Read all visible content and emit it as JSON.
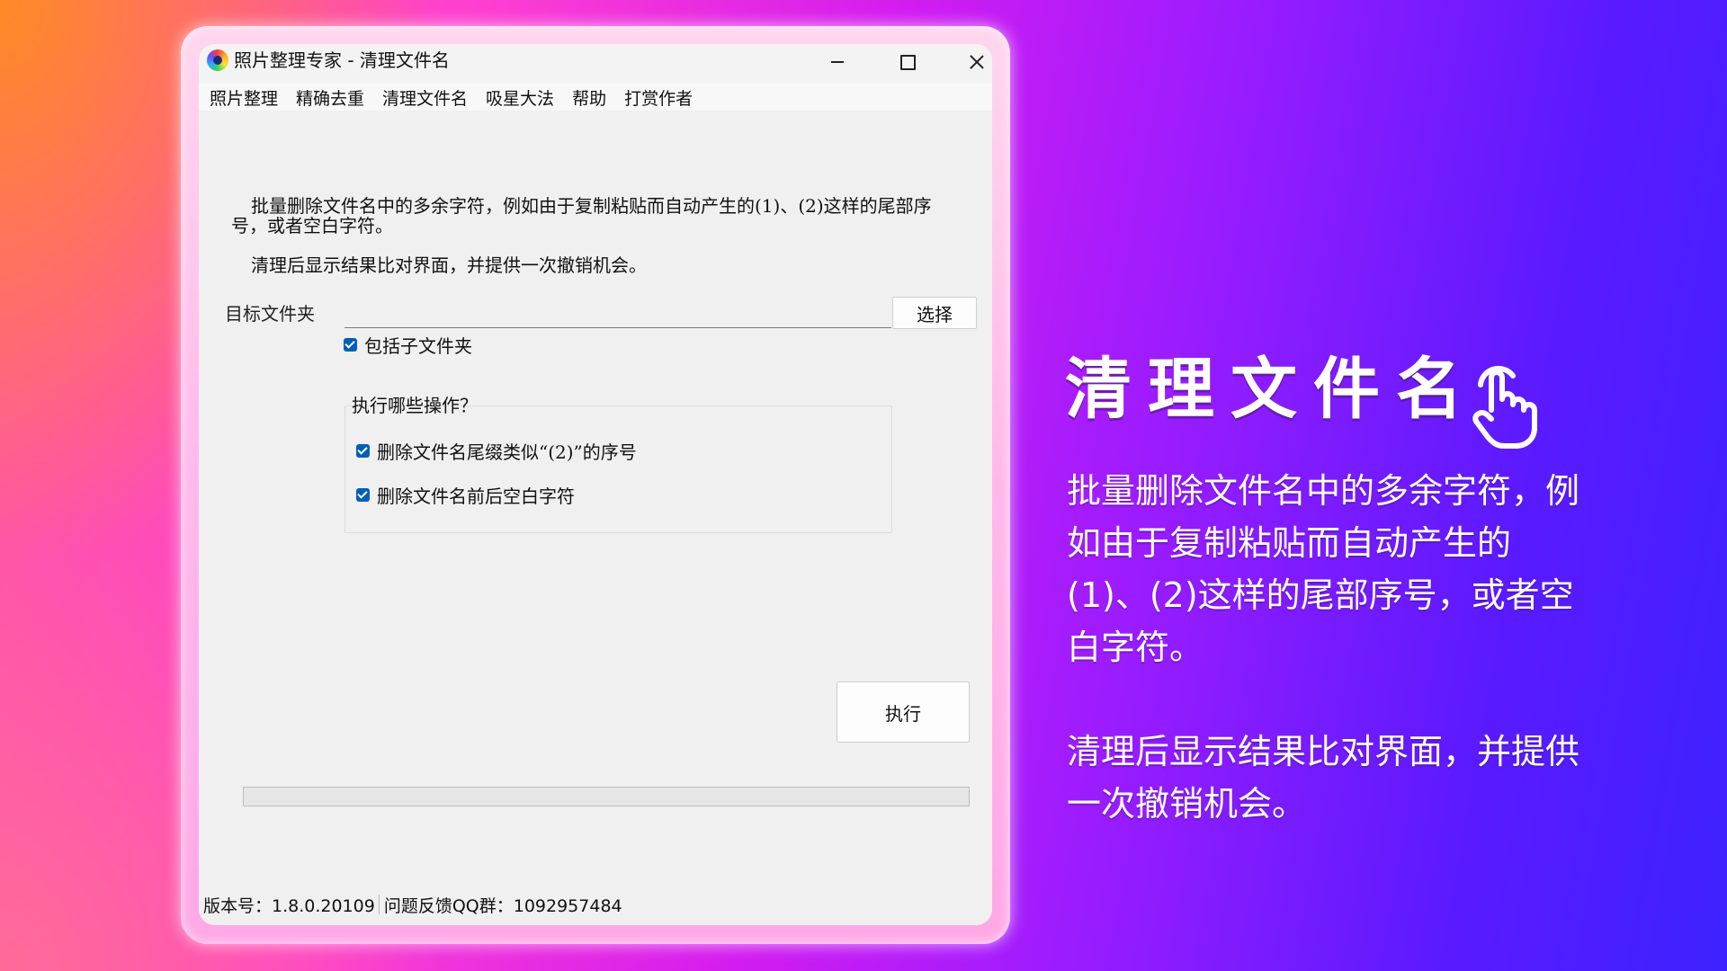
{
  "window": {
    "title": "照片整理专家 - 清理文件名",
    "controls": {
      "minimize": "minimize",
      "maximize": "maximize",
      "close": "close"
    }
  },
  "menu": [
    "照片整理",
    "精确去重",
    "清理文件名",
    "吸星大法",
    "帮助",
    "打赏作者"
  ],
  "description": {
    "line1": "批量删除文件名中的多余字符，例如由于复制粘贴而自动产生的(1)、(2)这样的尾部序号，或者空白字符。",
    "line2": "清理后显示结果比对界面，并提供一次撤销机会。"
  },
  "target": {
    "label": "目标文件夹",
    "value": "",
    "select_button": "选择"
  },
  "include_subfolders": {
    "label": "包括子文件夹",
    "checked": true
  },
  "operations": {
    "title": "执行哪些操作？",
    "items": [
      {
        "label": "删除文件名尾缀类似“(2)”的序号",
        "checked": true
      },
      {
        "label": "删除文件名前后空白字符",
        "checked": true
      }
    ]
  },
  "run_button": "执行",
  "progress": {
    "percent": 0
  },
  "status": {
    "version": "版本号：1.8.0.20109",
    "feedback": "问题反馈QQ群：1092957484"
  },
  "promo": {
    "headline": "清理文件名",
    "para1": "批量删除文件名中的多余字符，例如由于复制粘贴而自动产生的(1)、(2)这样的尾部序号，或者空白字符。",
    "para2": "清理后显示结果比对界面，并提供一次撤销机会。"
  },
  "icons": {
    "app": "app-logo-icon",
    "promo": "pointer-hand-icon"
  }
}
